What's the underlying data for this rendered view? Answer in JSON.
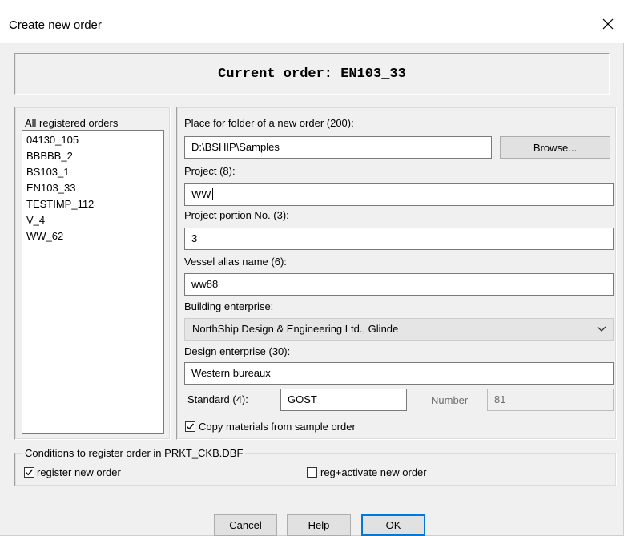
{
  "window": {
    "title": "Create new order",
    "close_glyph": "✕"
  },
  "current_order": {
    "text": "Current order: EN103_33"
  },
  "orders_list": {
    "label": "All registered orders",
    "items": [
      "04130_105",
      "BBBBB_2",
      "BS103_1",
      "EN103_33",
      "TESTIMP_112",
      "V_4",
      "WW_62"
    ]
  },
  "form": {
    "folder": {
      "label": "Place for folder of a new order (200):",
      "value": "D:\\BSHIP\\Samples"
    },
    "browse_label": "Browse...",
    "project": {
      "label": "Project (8):",
      "value": "WW"
    },
    "portion": {
      "label": "Project portion No. (3):",
      "value": "3"
    },
    "vessel": {
      "label": "Vessel alias name (6):",
      "value": "ww88"
    },
    "building": {
      "label": "Building enterprise:",
      "value": "NorthShip Design & Engineering Ltd., Glinde"
    },
    "design": {
      "label": "Design enterprise (30):",
      "value": "Western bureaux"
    },
    "standard": {
      "label": "Standard (4):",
      "value": "GOST"
    },
    "number": {
      "label": "Number",
      "value": "81"
    },
    "copy_materials": {
      "label": "Copy materials from sample order",
      "checked": true
    }
  },
  "conditions": {
    "title": "Conditions to register order in PRKT_CKB.DBF",
    "register": {
      "label": "register new order",
      "checked": true
    },
    "activate": {
      "label": "reg+activate new order",
      "checked": false
    }
  },
  "buttons": {
    "cancel": "Cancel",
    "help": "Help",
    "ok": "OK"
  },
  "colors": {
    "dialog_bg": "#f0f0f0",
    "default_button_border": "#0078d7"
  },
  "icons": {
    "close": "close-icon",
    "dropdown": "chevron-down-icon",
    "check": "checkmark-icon"
  }
}
